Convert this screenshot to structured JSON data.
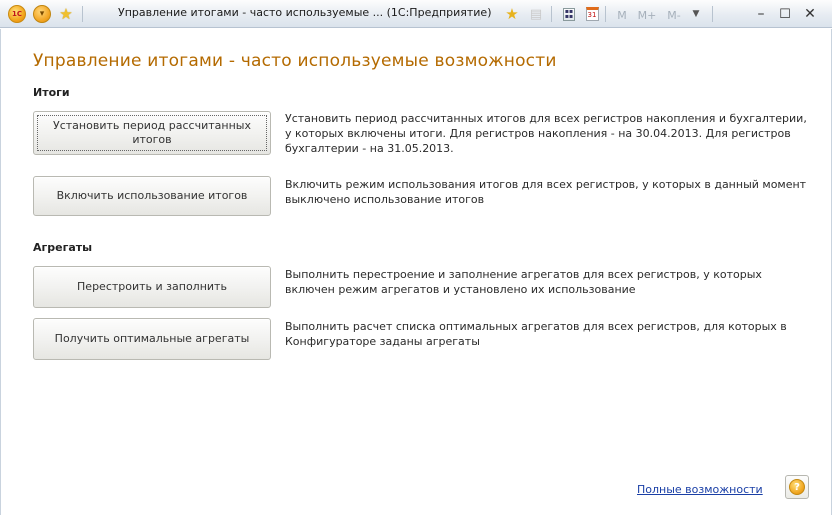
{
  "window": {
    "title": "Управление итогами - часто используемые ... (1С:Предприятие)",
    "logo_text": "1С"
  },
  "toolbar": {
    "mem_m": "M",
    "mem_mplus": "M+",
    "mem_mminus": "M-",
    "calendar_day": "31"
  },
  "page": {
    "title": "Управление итогами - часто используемые возможности"
  },
  "sections": {
    "totals": "Итоги",
    "aggregates": "Агрегаты"
  },
  "actions": {
    "set_period": {
      "label": "Установить период рассчитанных итогов",
      "description": "Установить период рассчитанных итогов для всех регистров накопления и бухгалтерии, у которых включены итоги. Для регистров накопления - на 30.04.2013. Для регистров бухгалтерии - на 31.05.2013."
    },
    "enable_totals": {
      "label": "Включить использование итогов",
      "description": "Включить режим использования итогов для всех регистров, у которых в данный момент выключено использование итогов"
    },
    "rebuild": {
      "label": "Перестроить и заполнить",
      "description": "Выполнить  перестроение и заполнение агрегатов для всех регистров, у которых включен режим агрегатов и установлено их использование"
    },
    "optimal": {
      "label": "Получить оптимальные агрегаты",
      "description": "Выполнить расчет списка оптимальных агрегатов для всех регистров, для которых в Конфигураторе заданы агрегаты"
    }
  },
  "footer": {
    "full_link": "Полные возможности",
    "help_symbol": "?"
  }
}
